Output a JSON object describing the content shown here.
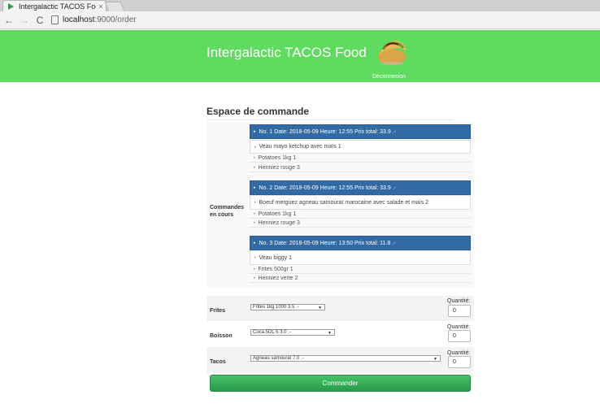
{
  "browser": {
    "tab_title": "Intergalactic TACOS Food",
    "tab_close": "×",
    "url_host": "localhost",
    "url_path": ":9000/order"
  },
  "header": {
    "brand": "Intergalactic TACOS Food",
    "logout": "Déconnexion"
  },
  "page": {
    "section_title": "Espace de commande",
    "orders_label_line1": "Commandes",
    "orders_label_line2": "en cours"
  },
  "orders": [
    {
      "header": "No. 1 Date: 2018-05-09 Heure: 12:55 Prix total: 33.9 .-",
      "main_item": "Veau mayo ketchup avec maïs 1",
      "sides": [
        "Potatoes 1kg 1",
        "Henniez rouge 3"
      ]
    },
    {
      "header": "No. 2 Date: 2018-05-09 Heure: 12:55 Prix total: 33.9 .-",
      "main_item": "Boeuf merguez agneau samouraï marocaine avec salade et maïs 2",
      "sides": [
        "Potatoes 1kg 1",
        "Henniez rouge 3"
      ]
    },
    {
      "header": "No. 3 Date: 2018-05-09 Heure: 13:50 Prix total: 11.8 .-",
      "main_item": "Veau biggy 1",
      "sides": [
        "Frites 500gr 1",
        "Henniez verte 2"
      ]
    }
  ],
  "form": {
    "frites": {
      "label": "Frites",
      "selected": "Frites 1kg 1000 3.5 .-",
      "qty_label": "Quantité:",
      "qty_value": "0"
    },
    "boisson": {
      "label": "Boisson",
      "selected": "Coca.5DL 5 3.0 .-",
      "qty_label": "Quantité:",
      "qty_value": "0"
    },
    "tacos": {
      "label": "Tacos",
      "selected": "Agneau samouraï 7.0 .-",
      "qty_label": "Quantité:",
      "qty_value": "0"
    },
    "submit_label": "Commander"
  },
  "icons": {
    "back": "←",
    "forward": "→",
    "reload": "C",
    "arrow_down": "▼",
    "bullet": "▸"
  }
}
